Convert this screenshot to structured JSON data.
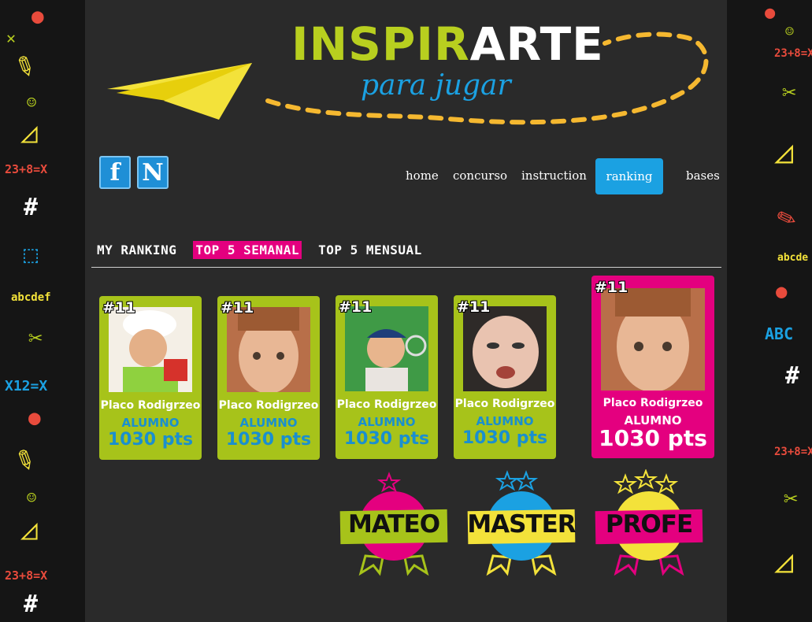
{
  "logo": {
    "title_part1": "INSPIR",
    "title_part2": "ARTE",
    "subtitle": "para jugar"
  },
  "social": [
    {
      "label": "f",
      "icon": "facebook-icon"
    },
    {
      "label": "N",
      "icon": "n-social-icon"
    }
  ],
  "nav": {
    "items": [
      {
        "label": "home"
      },
      {
        "label": "concurso"
      },
      {
        "label": "instruction"
      },
      {
        "label": "ranking",
        "active": true
      },
      {
        "label": "bases"
      }
    ]
  },
  "tabs": [
    {
      "label": "MY RANKING"
    },
    {
      "label": "TOP 5 SEMANAL",
      "active": true
    },
    {
      "label": "TOP 5 MENSUAL"
    }
  ],
  "cards": [
    {
      "rank": "#11",
      "name": "Placo Rodigrzeo",
      "role": "ALUMNO",
      "points": "1030 pts"
    },
    {
      "rank": "#11",
      "name": "Placo Rodigrzeo",
      "role": "ALUMNO",
      "points": "1030 pts"
    },
    {
      "rank": "#11",
      "name": "Placo Rodigrzeo",
      "role": "ALUMNO",
      "points": "1030 pts"
    },
    {
      "rank": "#11",
      "name": "Placo Rodigrzeo",
      "role": "ALUMNO",
      "points": "1030 pts"
    },
    {
      "rank": "#11",
      "name": "Placo Rodigrzeo",
      "role": "ALUMNO",
      "points": "1030 pts",
      "highlight": true
    }
  ],
  "badges": [
    {
      "label": "MATEO"
    },
    {
      "label": "MASTER"
    },
    {
      "label": "PROFE"
    }
  ],
  "doodles": {
    "left": [
      "23+8=X",
      "abcdef",
      "X12=X",
      "23+8=X"
    ],
    "right": [
      "23+8=X",
      "abcde",
      "ABC",
      "23+8=X"
    ]
  },
  "colors": {
    "accent_green": "#a7c31a",
    "accent_pink": "#e4007f",
    "accent_blue": "#1ba1e2"
  }
}
